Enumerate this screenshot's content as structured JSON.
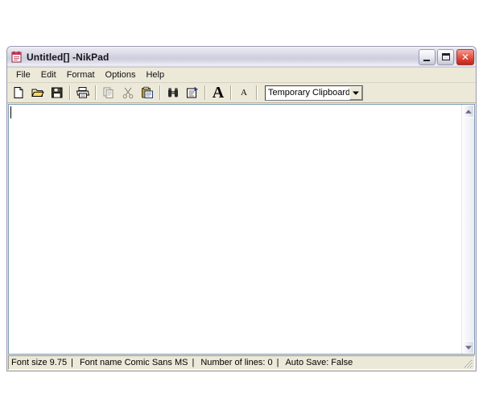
{
  "window": {
    "title": "Untitled[] -NikPad",
    "app_icon": "notepad-icon",
    "controls": {
      "minimize_label": "Minimize",
      "maximize_label": "Maximize",
      "close_label": "Close"
    }
  },
  "menubar": {
    "items": [
      {
        "label": "File"
      },
      {
        "label": "Edit"
      },
      {
        "label": "Format"
      },
      {
        "label": "Options"
      },
      {
        "label": "Help"
      }
    ]
  },
  "toolbar": {
    "buttons": [
      {
        "name": "new-file",
        "icon": "new-document-icon",
        "tooltip": "New"
      },
      {
        "name": "open-file",
        "icon": "open-folder-icon",
        "tooltip": "Open"
      },
      {
        "name": "save-file",
        "icon": "save-floppy-icon",
        "tooltip": "Save"
      },
      {
        "name": "print",
        "icon": "printer-icon",
        "tooltip": "Print"
      },
      {
        "name": "copy",
        "icon": "copy-icon",
        "tooltip": "Copy",
        "enabled": false
      },
      {
        "name": "cut",
        "icon": "scissors-icon",
        "tooltip": "Cut",
        "enabled": false
      },
      {
        "name": "paste",
        "icon": "paste-clipboard-icon",
        "tooltip": "Paste"
      },
      {
        "name": "find",
        "icon": "binoculars-icon",
        "tooltip": "Find"
      },
      {
        "name": "replace",
        "icon": "replace-document-icon",
        "tooltip": "Replace"
      },
      {
        "name": "increase-font",
        "icon": "large-a-icon",
        "glyph": "A",
        "tooltip": "Increase font size"
      },
      {
        "name": "decrease-font",
        "icon": "small-a-icon",
        "glyph": "A",
        "tooltip": "Decrease font size"
      }
    ],
    "clipboard_select": {
      "value": "Temporary Clipboard",
      "options": [
        "Temporary Clipboard"
      ]
    }
  },
  "editor": {
    "content": "",
    "placeholder": ""
  },
  "scrollbar": {
    "up_arrow": "▲",
    "down_arrow": "▼"
  },
  "statusbar": {
    "font_size": "Font size 9.75",
    "separator": "|",
    "font_name": "Font name Comic Sans MS",
    "line_count": "Number of lines:  0",
    "auto_save": "Auto Save: False"
  },
  "colors": {
    "titlebar_gradient_top": "#f4f3f8",
    "titlebar_gradient_bottom": "#c3c2d2",
    "window_face": "#ece9d8",
    "close_button": "#d83c2c",
    "editor_background": "#ffffff",
    "editor_border": "#7f9db9",
    "desktop_background": "#ffffff"
  }
}
